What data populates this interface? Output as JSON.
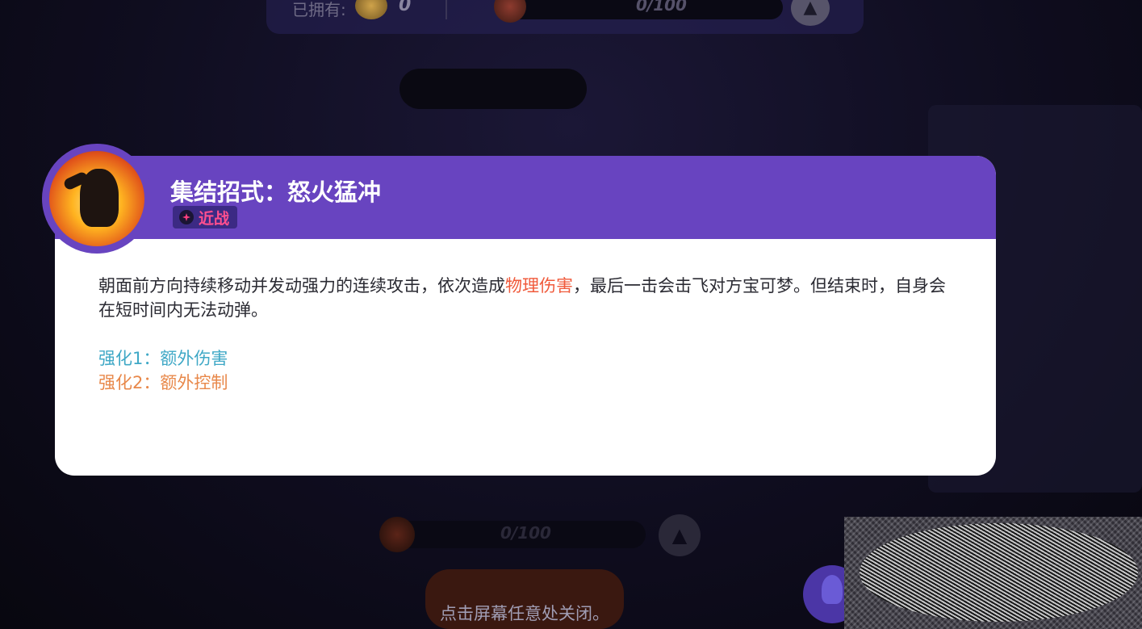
{
  "topbar": {
    "owned_label": "已拥有:",
    "owned_count": "0",
    "progress_text": "0/100"
  },
  "card": {
    "title": "集结招式：怒火猛冲",
    "tag_label": "近战",
    "description_part1": "朝面前方向持续移动并发动强力的连续攻击，依次造成",
    "description_highlight": "物理伤害",
    "description_part2": "，最后一击会击飞对方宝可梦。但结束时，自身会在短时间内无法动弹。",
    "enhancement_1": "强化1：额外伤害",
    "enhancement_2": "强化2：额外控制"
  },
  "bottom": {
    "progress_text": "0/100",
    "close_hint": "点击屏幕任意处关闭。"
  },
  "colors": {
    "header_purple": "#6844c0",
    "tag_pink": "#ff4f8f",
    "highlight_red": "#f05a3b",
    "enh1_blue": "#3fa8c6",
    "enh2_orange": "#e8884a"
  }
}
